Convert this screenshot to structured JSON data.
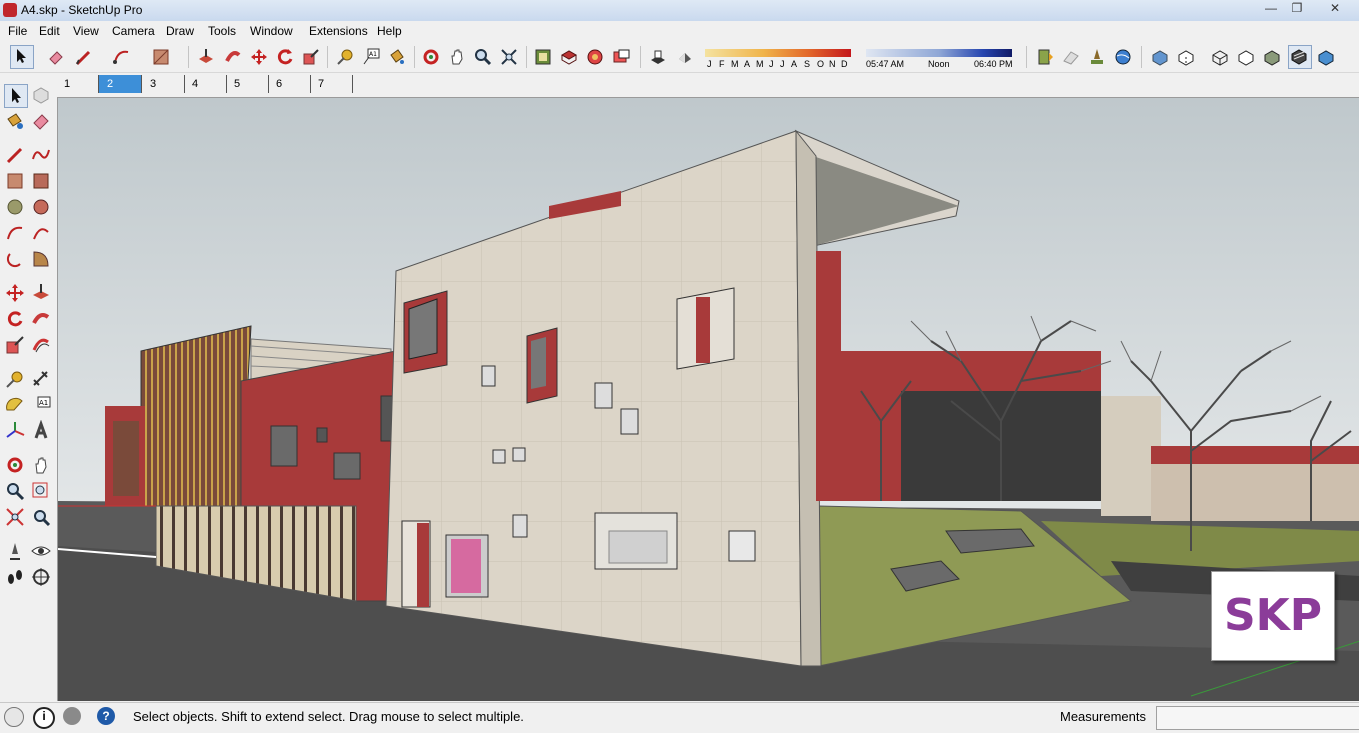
{
  "window": {
    "title": "A4.skp - SketchUp Pro",
    "minimize_icon": "minimize-icon",
    "maximize_icon": "maximize-icon",
    "close_icon": "close-icon"
  },
  "menu": {
    "items": [
      "File",
      "Edit",
      "View",
      "Camera",
      "Draw",
      "Tools",
      "Window",
      "Extensions",
      "Help"
    ]
  },
  "shadow_settings": {
    "months": [
      "J",
      "F",
      "M",
      "A",
      "M",
      "J",
      "J",
      "A",
      "S",
      "O",
      "N",
      "D"
    ],
    "time_start": "05:47 AM",
    "time_mid": "Noon",
    "time_end": "06:40 PM"
  },
  "scenes": {
    "tabs": [
      "1",
      "2",
      "3",
      "4",
      "5",
      "6",
      "7"
    ],
    "active_index": 1
  },
  "badge": {
    "text": "SKP",
    "color": "#8b3c99"
  },
  "status": {
    "message": "Select objects. Shift to extend select. Drag mouse to select multiple.",
    "measurements_label": "Measurements",
    "measurements_value": ""
  },
  "colors": {
    "titlebar": "#c9d9ee",
    "wall_beige": "#dcd5c8",
    "wall_red": "#a83a3a",
    "ground": "#555555",
    "grass": "#8f9a55",
    "sky": "#cfd5d8"
  }
}
